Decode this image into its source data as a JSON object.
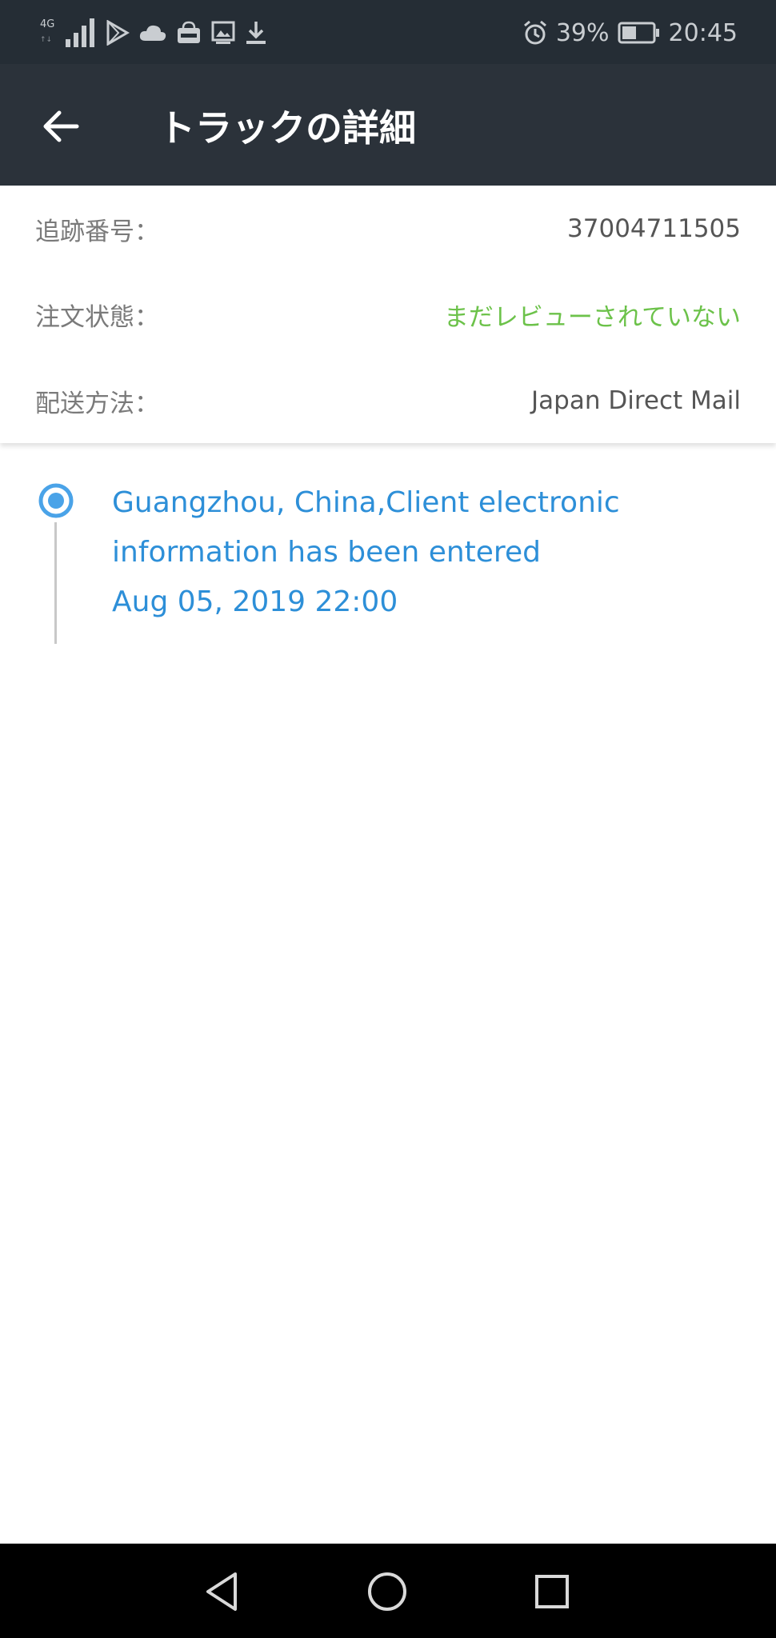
{
  "status_bar": {
    "network": "4G",
    "battery": "39%",
    "time": "20:45",
    "icons": [
      "network-4g-icon",
      "signal-icon",
      "play-store-icon",
      "cloud-icon",
      "market-icon",
      "photo-icon",
      "download-icon",
      "alarm-icon",
      "battery-icon"
    ]
  },
  "app_bar": {
    "title": "トラックの詳細",
    "back_icon": "arrow-left-icon"
  },
  "info": {
    "tracking_label": "追跡番号：",
    "tracking_value": "37004711505",
    "status_label": "注文状態：",
    "status_value": "まだレビューされていない",
    "status_color": "#6cc24a",
    "method_label": "配送方法：",
    "method_value": "Japan Direct Mail"
  },
  "timeline": {
    "events": [
      {
        "line1": "Guangzhou, China,Client electronic",
        "line2": "information has been entered",
        "time": "Aug 05, 2019 22:00"
      }
    ],
    "accent_color": "#2d8fd8"
  },
  "nav_bar": {
    "icons": [
      "back-triangle-icon",
      "home-circle-icon",
      "recents-square-icon"
    ]
  }
}
